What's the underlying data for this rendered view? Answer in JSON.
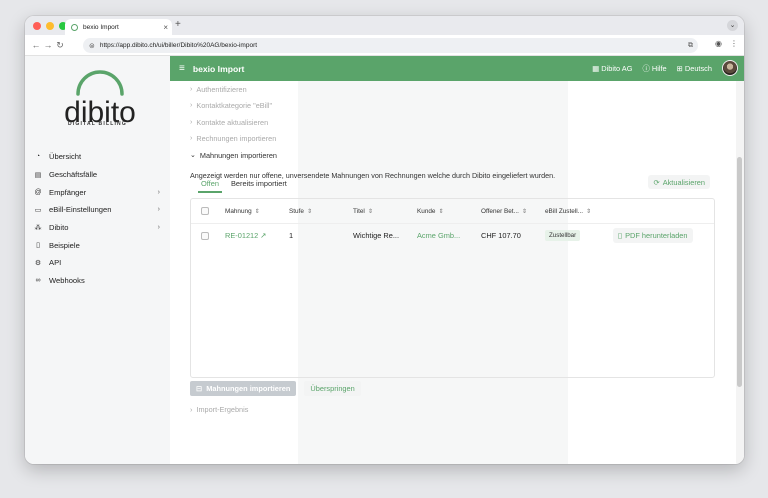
{
  "browser": {
    "tab_title": "bexio Import",
    "tab_close": "×",
    "new_tab": "+",
    "url": "https://app.dibito.ch/ui/biller/Dibito%20AG/bexio-import"
  },
  "sidebar": {
    "logo_text": "dibito",
    "logo_subtitle": "DIGITAL BILLING",
    "items": [
      {
        "label": "Übersicht",
        "icon": "dashboard-icon",
        "has_children": false
      },
      {
        "label": "Geschäftsfälle",
        "icon": "document-icon",
        "has_children": false
      },
      {
        "label": "Empfänger",
        "icon": "at-icon",
        "has_children": true
      },
      {
        "label": "eBill-Einstellungen",
        "icon": "settings-card-icon",
        "has_children": true
      },
      {
        "label": "Dibito",
        "icon": "org-icon",
        "has_children": true
      },
      {
        "label": "Beispiele",
        "icon": "file-icon",
        "has_children": false
      },
      {
        "label": "API",
        "icon": "api-icon",
        "has_children": false
      },
      {
        "label": "Webhooks",
        "icon": "webhook-icon",
        "has_children": false
      }
    ]
  },
  "appbar": {
    "title": "bexio Import",
    "company": "Dibito AG",
    "help": "Hilfe",
    "language": "Deutsch"
  },
  "steps": {
    "s1": "Authentifizieren",
    "s2": "Kontaktkategorie \"eBill\"",
    "s3": "Kontakte aktualisieren",
    "s4": "Rechnungen importieren",
    "s5": "Mahnungen importieren",
    "s6": "Import-Ergebnis"
  },
  "info_text": "Angezeigt werden nur offene, unversendete Mahnungen von Rechnungen welche durch Dibito eingeliefert wurden.",
  "tabs": {
    "open": "Offen",
    "imported": "Bereits importiert",
    "refresh": "Aktualisieren"
  },
  "table": {
    "columns": {
      "mahnung": "Mahnung",
      "stufe": "Stufe",
      "titel": "Titel",
      "kunde": "Kunde",
      "offener_betrag": "Offener Bet...",
      "ebill": "eBill Zustell..."
    },
    "rows": [
      {
        "mahnung": "RE-01212",
        "stufe": "1",
        "titel": "Wichtige Re...",
        "kunde": "Acme Gmb...",
        "betrag": "CHF 107.70",
        "ebill": "Zustellbar",
        "pdf": "PDF herunterladen"
      }
    ]
  },
  "actions": {
    "import": "Mahnungen importieren",
    "skip": "Überspringen"
  },
  "colors": {
    "brand_green": "#5aa46a"
  }
}
